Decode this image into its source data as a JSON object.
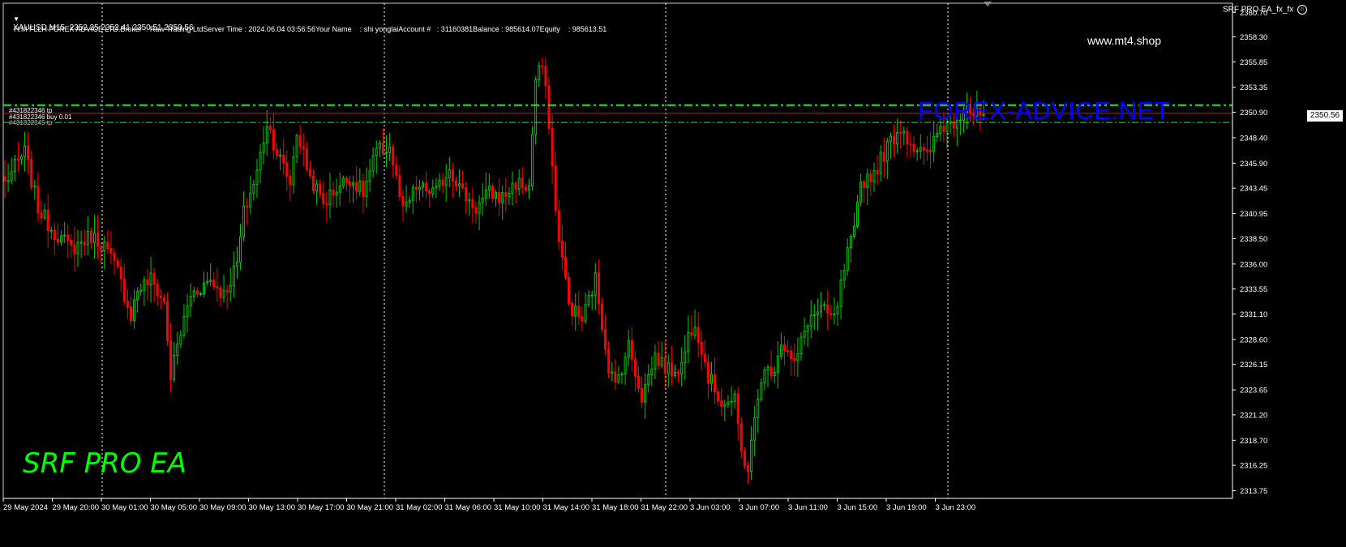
{
  "header": {
    "symbol_line": "XAUUSD,M15  2352.25 2352.41 2350.51 2350.56",
    "info_line": "H.M FLLH FOREX ADVICE LTD.Broker  : Raw Trading LtdServer Time : 2024.06.04 03:56:56Your Name    : shi yonglaiAccount #   : 31160381Balance : 985614.07Equity    : 985613.51",
    "ea_name": "SRF PRO EA_fx_fx"
  },
  "watermarks": {
    "site": "www.mt4.shop",
    "forex_advice": "FOREX-ADVICE.NET",
    "ea_title": "SRF PRO EA"
  },
  "orders": {
    "tp_label": "#431822346 tp",
    "buy_label": "#431822346 buy 0.01",
    "tp2_label": "#431822345 tp"
  },
  "current_price": "2350.56",
  "colors": {
    "bull": "#00c800",
    "bear": "#ff0000",
    "grid": "#ffffff",
    "axis": "#ffffff",
    "green_line": "#00ff00",
    "red_line": "#ff0000",
    "brand_green": "#00ff00",
    "brand_blue": "#0000ff"
  },
  "chart_data": {
    "type": "candlestick",
    "symbol": "XAUUSD",
    "timeframe": "M15",
    "y_ticks": [
      "2360.70",
      "2358.30",
      "2355.85",
      "2353.35",
      "2350.90",
      "2348.40",
      "2345.90",
      "2343.45",
      "2340.95",
      "2338.50",
      "2336.00",
      "2333.55",
      "2331.10",
      "2328.60",
      "2326.15",
      "2323.65",
      "2321.20",
      "2318.70",
      "2316.25",
      "2313.75"
    ],
    "x_ticks": [
      "29 May 2024",
      "29 May 20:00",
      "30 May 01:00",
      "30 May 05:00",
      "30 May 09:00",
      "30 May 13:00",
      "30 May 17:00",
      "30 May 21:00",
      "31 May 02:00",
      "31 May 06:00",
      "31 May 10:00",
      "31 May 14:00",
      "31 May 18:00",
      "31 May 22:00",
      "3 Jun 03:00",
      "3 Jun 07:00",
      "3 Jun 11:00",
      "3 Jun 15:00",
      "3 Jun 19:00",
      "3 Jun 23:00"
    ],
    "ylim": [
      2313.0,
      2361.6
    ],
    "order_levels": {
      "tp_green_upper": 2351.6,
      "buy_red": 2350.8,
      "tp_green_lower": 2349.9
    },
    "anchors": [
      [
        0,
        2344.0
      ],
      [
        6,
        2347.0
      ],
      [
        10,
        2341.5
      ],
      [
        14,
        2339.5
      ],
      [
        20,
        2337.5
      ],
      [
        26,
        2338.8
      ],
      [
        30,
        2337.8
      ],
      [
        34,
        2335.2
      ],
      [
        38,
        2331.0
      ],
      [
        40,
        2333.5
      ],
      [
        44,
        2334.5
      ],
      [
        48,
        2332.2
      ],
      [
        50,
        2325.0
      ],
      [
        52,
        2328.0
      ],
      [
        56,
        2333.0
      ],
      [
        62,
        2334.5
      ],
      [
        66,
        2333.0
      ],
      [
        70,
        2336.0
      ],
      [
        72,
        2341.0
      ],
      [
        76,
        2345.0
      ],
      [
        79,
        2350.0
      ],
      [
        82,
        2347.0
      ],
      [
        86,
        2344.0
      ],
      [
        88,
        2349.0
      ],
      [
        92,
        2344.5
      ],
      [
        96,
        2342.0
      ],
      [
        100,
        2343.5
      ],
      [
        104,
        2344.5
      ],
      [
        108,
        2343.0
      ],
      [
        112,
        2347.0
      ],
      [
        116,
        2347.5
      ],
      [
        120,
        2341.0
      ],
      [
        124,
        2343.5
      ],
      [
        130,
        2343.0
      ],
      [
        134,
        2345.5
      ],
      [
        138,
        2343.0
      ],
      [
        142,
        2341.5
      ],
      [
        146,
        2343.0
      ],
      [
        150,
        2342.5
      ],
      [
        154,
        2344.0
      ],
      [
        158,
        2343.5
      ],
      [
        160,
        2354.0
      ],
      [
        162,
        2355.5
      ],
      [
        164,
        2350.0
      ],
      [
        166,
        2341.0
      ],
      [
        170,
        2332.0
      ],
      [
        174,
        2330.5
      ],
      [
        178,
        2334.5
      ],
      [
        182,
        2326.0
      ],
      [
        184,
        2324.0
      ],
      [
        188,
        2328.0
      ],
      [
        192,
        2323.0
      ],
      [
        196,
        2327.0
      ],
      [
        200,
        2325.5
      ],
      [
        204,
        2326.0
      ],
      [
        206,
        2329.0
      ],
      [
        208,
        2330.5
      ],
      [
        212,
        2325.0
      ],
      [
        216,
        2322.5
      ],
      [
        220,
        2322.5
      ],
      [
        222,
        2317.5
      ],
      [
        224,
        2316.0
      ],
      [
        228,
        2325.0
      ],
      [
        232,
        2326.0
      ],
      [
        234,
        2328.5
      ],
      [
        238,
        2326.0
      ],
      [
        242,
        2330.5
      ],
      [
        246,
        2331.5
      ],
      [
        250,
        2330.5
      ],
      [
        254,
        2337.0
      ],
      [
        256,
        2339.0
      ],
      [
        258,
        2344.0
      ],
      [
        262,
        2345.0
      ],
      [
        266,
        2347.5
      ],
      [
        270,
        2349.5
      ],
      [
        274,
        2347.5
      ],
      [
        278,
        2346.5
      ],
      [
        282,
        2349.5
      ],
      [
        286,
        2350.0
      ],
      [
        290,
        2351.8
      ],
      [
        292,
        2350.5
      ],
      [
        295,
        2350.56
      ]
    ]
  }
}
